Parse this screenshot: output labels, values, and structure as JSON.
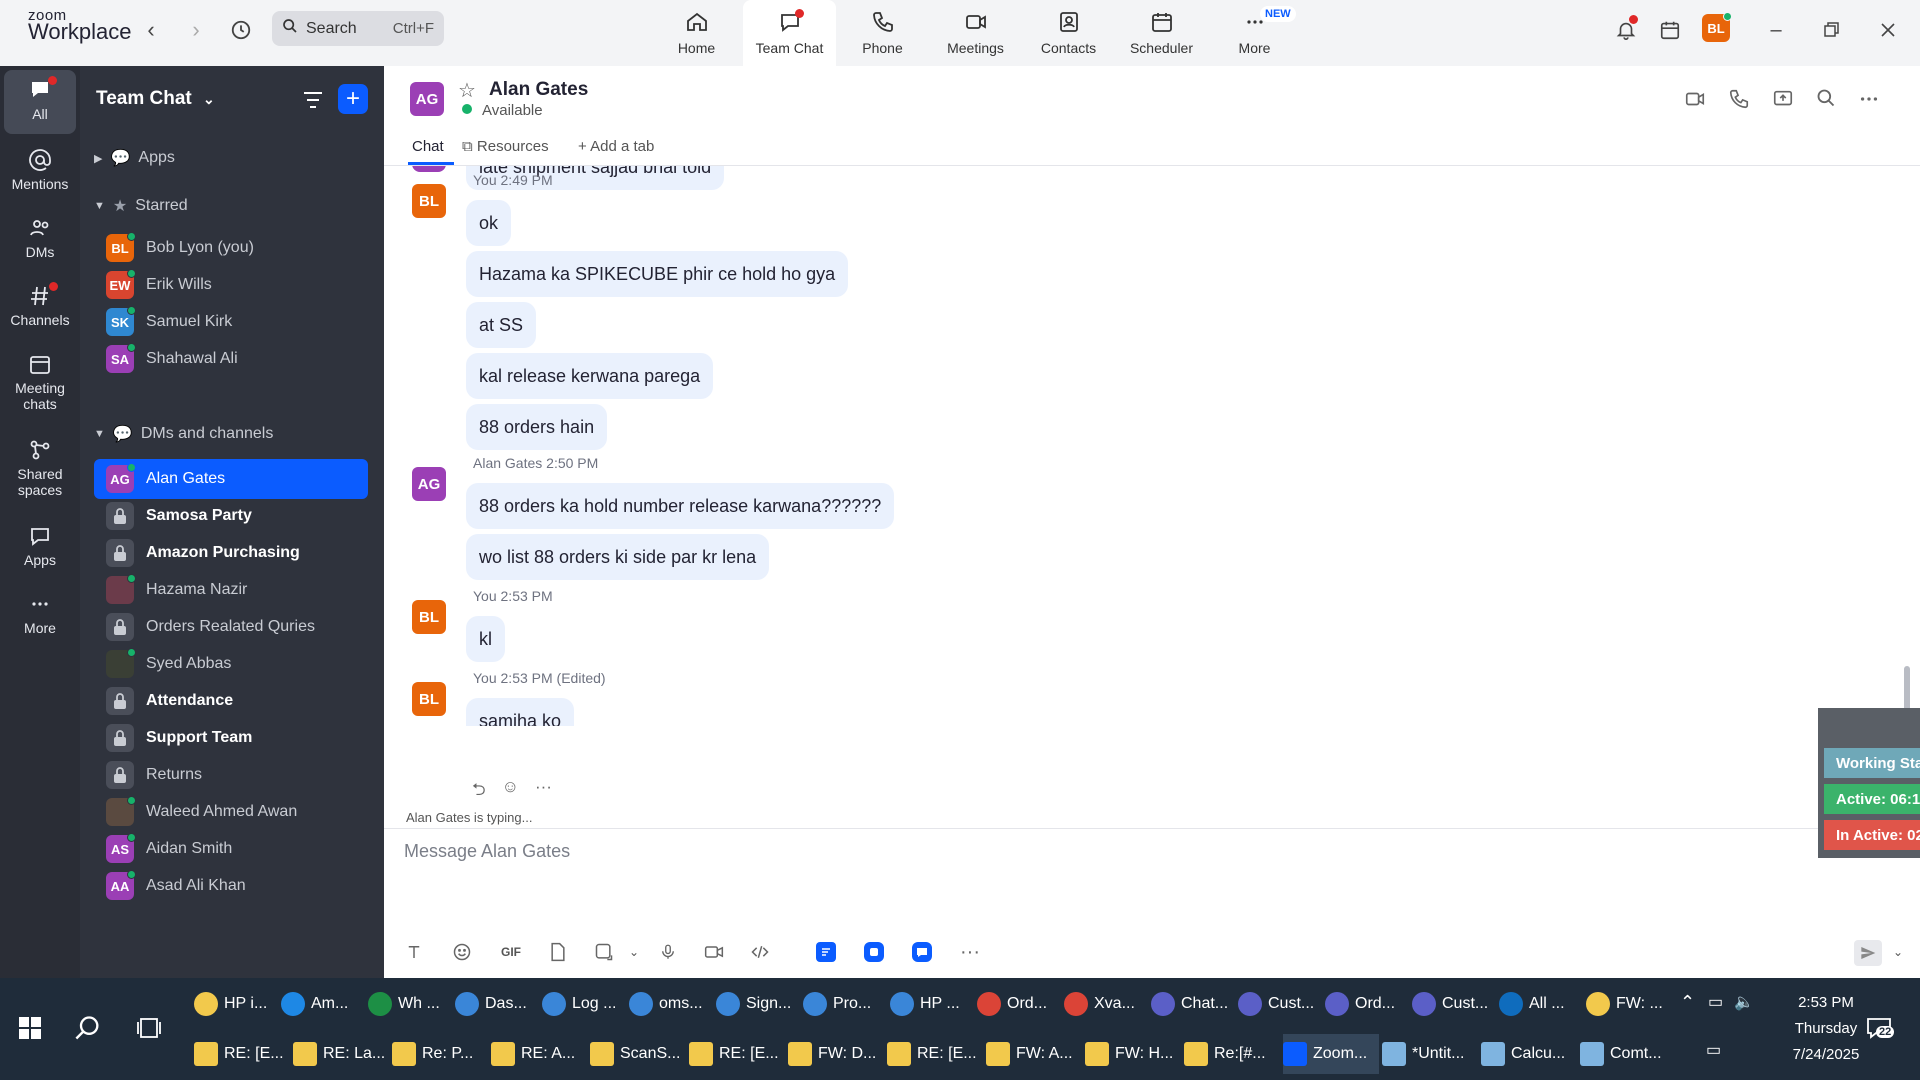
{
  "app": {
    "logo_line1": "zoom",
    "logo_line2": "Workplace",
    "search_label": "Search",
    "search_shortcut": "Ctrl+F"
  },
  "topnav": [
    {
      "label": "Home",
      "icon": "home-icon"
    },
    {
      "label": "Team Chat",
      "icon": "chat-icon"
    },
    {
      "label": "Phone",
      "icon": "phone-icon"
    },
    {
      "label": "Meetings",
      "icon": "video-icon"
    },
    {
      "label": "Contacts",
      "icon": "contacts-icon"
    },
    {
      "label": "Scheduler",
      "icon": "calendar-icon"
    },
    {
      "label": "More",
      "icon": "more-icon",
      "badge": "NEW"
    }
  ],
  "user_initials": "BL",
  "rail": [
    {
      "label": "All"
    },
    {
      "label": "Mentions"
    },
    {
      "label": "DMs"
    },
    {
      "label": "Channels"
    },
    {
      "label": "Meeting chats"
    },
    {
      "label": "Shared spaces"
    },
    {
      "label": "Apps"
    },
    {
      "label": "More"
    }
  ],
  "sidebar": {
    "title": "Team Chat",
    "sections": {
      "apps": "Apps",
      "starred": "Starred",
      "dms": "DMs and channels"
    },
    "starred": [
      {
        "initials": "BL",
        "name": "Bob Lyon (you)",
        "color": "#e8650a"
      },
      {
        "initials": "EW",
        "name": "Erik Wills",
        "color": "#d9452f"
      },
      {
        "initials": "SK",
        "name": "Samuel Kirk",
        "color": "#2f88d1"
      },
      {
        "initials": "SA",
        "name": "Shahawal Ali",
        "color": "#9b3fb5"
      }
    ],
    "channels": [
      {
        "name": "Alan Gates",
        "initials": "AG",
        "color": "#9b3fb5",
        "type": "dm",
        "selected": true
      },
      {
        "name": "Samosa Party",
        "type": "lock",
        "bold": true
      },
      {
        "name": "Amazon Purchasing",
        "type": "lock",
        "bold": true
      },
      {
        "name": "Hazama Nazir",
        "type": "photo",
        "color": "#6b3b4a"
      },
      {
        "name": "Orders Realated Quries",
        "type": "lock"
      },
      {
        "name": "Syed Abbas",
        "type": "photo",
        "color": "#3a3f35"
      },
      {
        "name": "Attendance",
        "type": "lock",
        "bold": true
      },
      {
        "name": "Support Team",
        "type": "lock",
        "bold": true
      },
      {
        "name": "Returns",
        "type": "lock"
      },
      {
        "name": "Waleed Ahmed Awan",
        "type": "photo",
        "color": "#5a4a40"
      },
      {
        "name": "Aidan Smith",
        "initials": "AS",
        "color": "#9b3fb5",
        "type": "dm"
      },
      {
        "name": "Asad Ali Khan",
        "initials": "AA",
        "color": "#9b3fb5",
        "type": "dm"
      }
    ]
  },
  "chat": {
    "contact": "Alan Gates",
    "contact_initials": "AG",
    "status": "Available",
    "tabs": {
      "chat": "Chat",
      "resources": "Resources",
      "add": "Add a tab"
    },
    "partial_message": "late shipment sajjad bhai told",
    "groups": [
      {
        "sender": "You",
        "initials": "BL",
        "time": "2:49 PM",
        "edited": "",
        "messages": [
          "ok",
          "Hazama ka SPIKECUBE phir ce hold ho gya",
          "at SS",
          "kal release kerwana parega",
          "88 orders hain"
        ]
      },
      {
        "sender": "Alan Gates",
        "initials": "AG",
        "time": "2:50 PM",
        "edited": "",
        "messages": [
          "88 orders ka hold number release karwana??????",
          "wo list 88 orders ki side par kr lena"
        ]
      },
      {
        "sender": "You",
        "initials": "BL",
        "time": "2:53 PM",
        "edited": "",
        "messages": [
          "kl"
        ]
      },
      {
        "sender": "You",
        "initials": "BL",
        "time": "2:53 PM",
        "edited": "(Edited)",
        "messages": [
          "samjha ko"
        ]
      }
    ],
    "typing": "Alan Gates is typing...",
    "placeholder": "Message Alan Gates",
    "gif": "GIF"
  },
  "widget": {
    "working": "Working Sta",
    "active": "Active: 06:1",
    "inactive": "In Active: 02"
  },
  "taskbar": {
    "row1": [
      "HP i...",
      "Am...",
      "Wh ...",
      "Das...",
      "Log ...",
      "oms...",
      "Sign...",
      "Pro...",
      "HP ...",
      "Ord...",
      "Xva...",
      "Chat...",
      "Cust...",
      "Ord...",
      "Cust...",
      "All ...",
      "FW: ..."
    ],
    "row2": [
      "RE: [E...",
      "RE: La...",
      "Re: P...",
      "RE: A...",
      "ScanS...",
      "RE: [E...",
      "FW: D...",
      "RE: [E...",
      "FW: A...",
      "FW: H...",
      "Re:[#...",
      "Zoom...",
      "*Untit...",
      "Calcu...",
      "Comt..."
    ],
    "time": "2:53 PM",
    "day": "Thursday",
    "date": "7/24/2025",
    "notif_count": "22"
  }
}
